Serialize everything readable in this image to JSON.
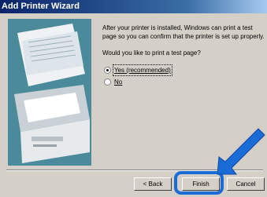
{
  "window": {
    "title": "Add Printer Wizard"
  },
  "main": {
    "message": "After your printer is installed, Windows can print a test page so you can confirm that the printer is set up properly.",
    "question": "Would you like to print a test page?",
    "options": [
      {
        "label": "Yes (recommended)",
        "selected": true
      },
      {
        "label": "No",
        "selected": false
      }
    ]
  },
  "buttons": {
    "back": "< Back",
    "finish": "Finish",
    "cancel": "Cancel"
  },
  "colors": {
    "highlight": "#1b6bd6",
    "titlebar": "#0a246a",
    "dialog_bg": "#d4d0c8"
  }
}
